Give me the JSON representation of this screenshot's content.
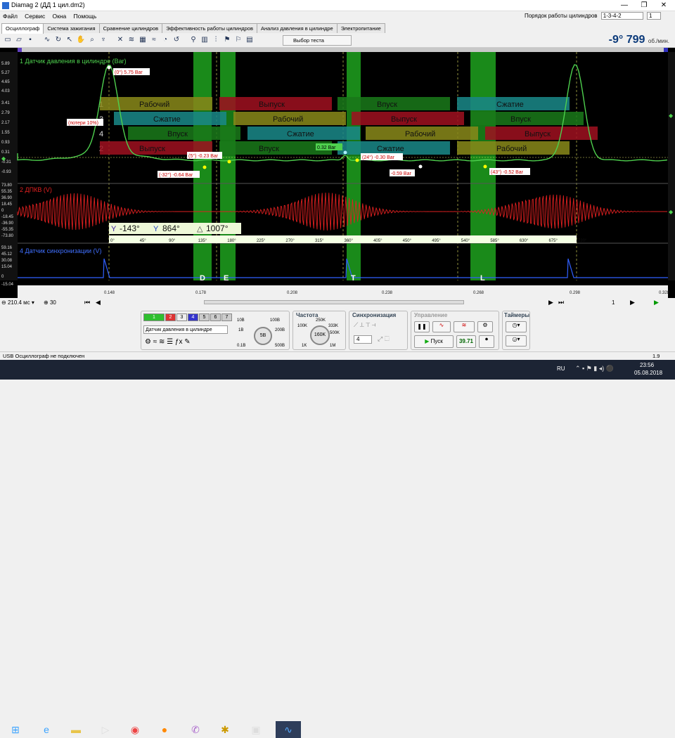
{
  "window": {
    "title": "Diamag 2 (ДД 1 цил.dm2)",
    "min": "—",
    "max": "❐",
    "close": "✕"
  },
  "menu": [
    "Файл",
    "Сервис",
    "Окна",
    "Помощь"
  ],
  "cylinder_order": {
    "label": "Порядок работы цилиндров",
    "value": "1-3-4-2",
    "spin": "1"
  },
  "tabs": [
    "Осциллограф",
    "Система зажигания",
    "Сравнение цилиндров",
    "Эффективность работы цилиндров",
    "Анализ давления в цилиндре",
    "Электропитание"
  ],
  "toolbar": {
    "test_select": "Выбор теста",
    "angle_value": "-9°",
    "rpm_value": "799",
    "rpm_unit": "об./мин."
  },
  "channel1": {
    "label": "1 Датчик давления в цилиндре (Bar)",
    "ticks": [
      "5.89",
      "5.27",
      "4.65",
      "4.03",
      "3.41",
      "2.79",
      "2.17",
      "1.55",
      "0.93",
      "0.31",
      "-0.31",
      "-0.93"
    ],
    "markers": {
      "peak": "(0°) 5.75 Bar",
      "loss": "(потери 10%)",
      "m5": "(5°) -0.23 Bar",
      "m32": "(-32°) -0.64 Bar",
      "val032": "0.32 Bar",
      "m24": "(24°) -0.30 Bar",
      "m059": "-0.59 Bar",
      "m43": "(43°) -0.52 Bar"
    },
    "cyl_rows": [
      {
        "num": "1",
        "cells": [
          "Рабочий",
          "Выпуск",
          "Впуск",
          "Сжатие"
        ]
      },
      {
        "num": "3",
        "cells": [
          "Сжатие",
          "Рабочий",
          "Выпуск",
          "Впуск"
        ]
      },
      {
        "num": "4",
        "cells": [
          "Впуск",
          "Сжатие",
          "Рабочий",
          "Выпуск"
        ]
      },
      {
        "num": "2",
        "cells": [
          "Выпуск",
          "Впуск",
          "Сжатие",
          "Рабочий"
        ]
      }
    ]
  },
  "channel2": {
    "label": "2 ДПКВ (V)",
    "ticks": [
      "73.80",
      "55.35",
      "36.90",
      "18.45",
      "0",
      "-18.45",
      "-36.90",
      "-55.35",
      "-73.80"
    ]
  },
  "angle_readout": {
    "a": "-143°",
    "b": "864°",
    "delta": "1007°"
  },
  "degree_scale": [
    "0°",
    "45°",
    "90°",
    "135°",
    "180°",
    "225°",
    "270°",
    "315°",
    "360°",
    "405°",
    "450°",
    "495°",
    "540°",
    "585°",
    "630°",
    "675°",
    "720°"
  ],
  "channel4": {
    "label": "4 Датчик синхронизации (V)",
    "ticks": [
      "59.16",
      "45.12",
      "30.08",
      "15.04",
      "0",
      "-15.04"
    ]
  },
  "zones": [
    "D",
    "E",
    "T",
    "L"
  ],
  "time_axis": [
    "0.148",
    "0.178",
    "0.208",
    "0.238",
    "0.268",
    "0.298",
    "0.328"
  ],
  "nav": {
    "timebase": "210.4 мс",
    "offset": "30",
    "page": "1"
  },
  "controls": {
    "channels": [
      "1",
      "2",
      "3",
      "4",
      "5",
      "6",
      "7"
    ],
    "sensor": "Датчик давления в цилиндре",
    "range_knob": {
      "center": "5B",
      "marks": [
        "10B",
        "100B",
        "1B",
        "200B",
        "0.1B",
        "500B"
      ]
    },
    "freq_title": "Частота",
    "freq_knob": {
      "center": "160K",
      "marks": [
        "250K",
        "100K",
        "333K",
        "500K",
        "1K",
        "1M"
      ]
    },
    "sync_title": "Синхронизация",
    "sync_value": "4",
    "control_title": "Управление",
    "start_label": "Пуск",
    "counter": "39.71",
    "timers_title": "Таймеры"
  },
  "status": {
    "left": "USB Осциллограф не подключен",
    "right": "1.9"
  },
  "taskbar": {
    "lang": "RU",
    "time": "23:56",
    "date": "05.08.2018"
  }
}
